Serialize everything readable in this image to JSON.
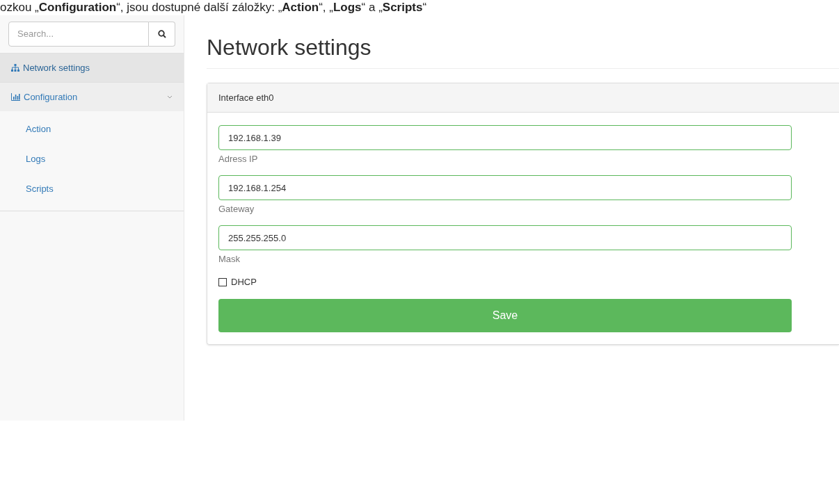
{
  "caption": "ozkou „**Configuration**“, jsou dostupné další záložky: „**Action**“, „**Logs**“ a „**Scripts**“",
  "sidebar": {
    "search": {
      "placeholder": "Search..."
    },
    "items": [
      {
        "label": "Network settings",
        "kind": "network",
        "selected": true
      },
      {
        "label": "Configuration",
        "kind": "chart",
        "selected": false,
        "expanded": true,
        "children": [
          {
            "label": "Action",
            "selected": false
          },
          {
            "label": "Logs",
            "selected": false
          },
          {
            "label": "Scripts",
            "selected": false
          }
        ]
      }
    ]
  },
  "page": {
    "title": "Network settings",
    "panel": {
      "title": "Interface eth0",
      "fields": [
        {
          "value": "192.168.1.39",
          "label": "Adress IP"
        },
        {
          "value": "192.168.1.254",
          "label": "Gateway"
        },
        {
          "value": "255.255.255.0",
          "label": "Mask"
        }
      ],
      "checkbox": {
        "label": "DHCP",
        "checked": false
      },
      "button": "Save"
    }
  }
}
